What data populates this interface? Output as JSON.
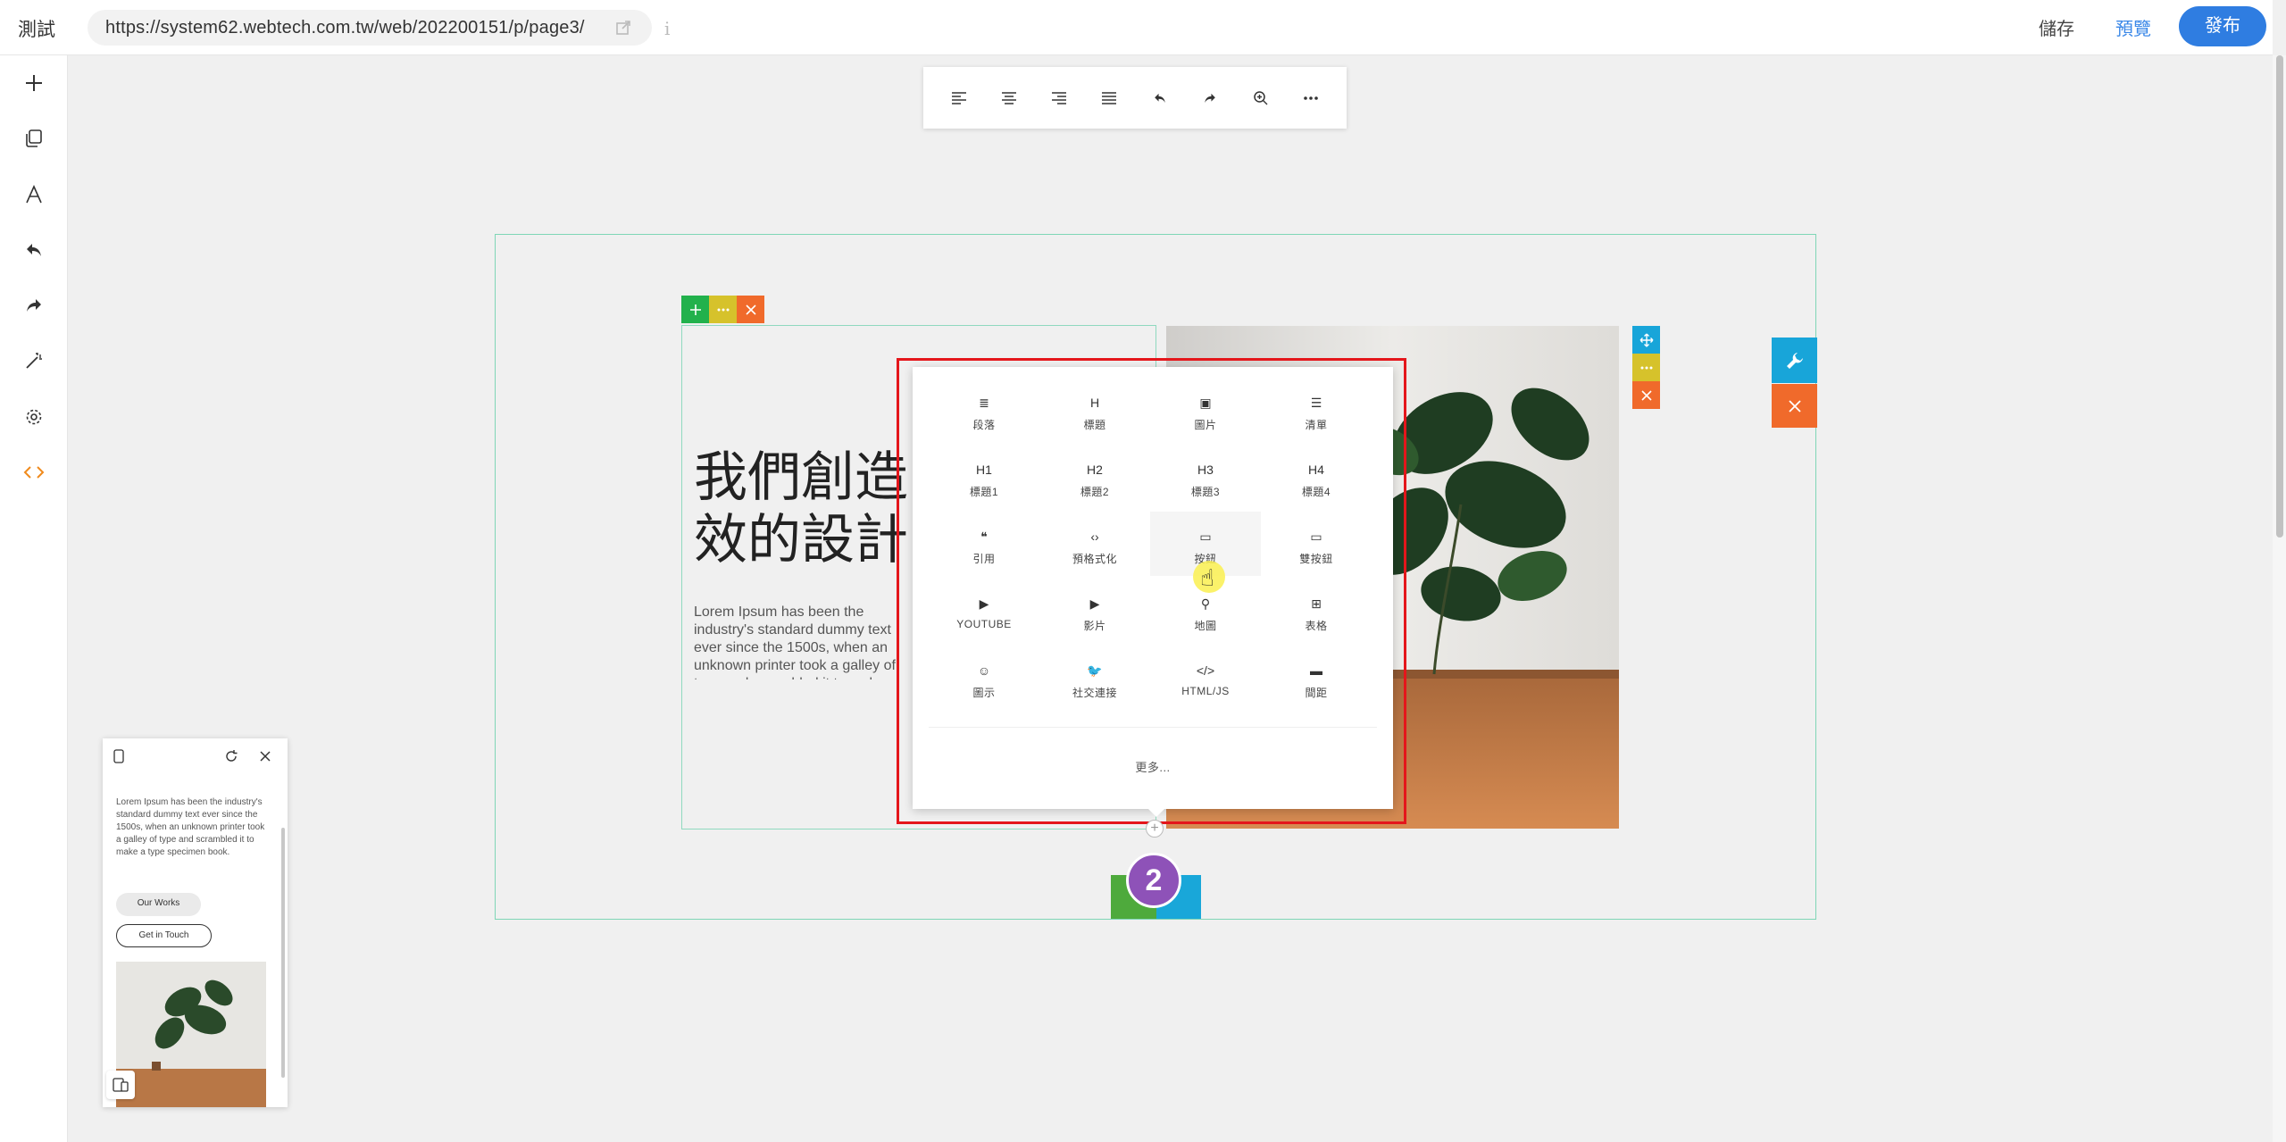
{
  "topbar": {
    "site_name": "測試",
    "url": "https://system62.webtech.com.tw/web/202200151/p/page3/",
    "info": "i",
    "save": "儲存",
    "preview": "預覽",
    "publish": "發布"
  },
  "sidebar": {
    "items": [
      "plus-icon",
      "pages-icon",
      "typography-icon",
      "undo-icon",
      "redo-icon",
      "magic-wand-icon",
      "gear-icon",
      "code-icon"
    ]
  },
  "format_toolbar": {
    "items": [
      "align-left-icon",
      "align-center-icon",
      "align-right-icon",
      "align-justify-icon",
      "undo-icon",
      "redo-icon",
      "zoom-icon",
      "more-icon"
    ]
  },
  "hero": {
    "title": "我們創造\n效的設計",
    "body": "Lorem Ipsum has been the industry's standard dummy text ever since the 1500s, when an unknown printer took a galley of type and scrambled it to make a type specimen book."
  },
  "picker": {
    "items": [
      {
        "icon": "≣",
        "label": "段落"
      },
      {
        "icon": "H",
        "label": "標題"
      },
      {
        "icon": "▣",
        "label": "圖片"
      },
      {
        "icon": "☰",
        "label": "清單"
      },
      {
        "icon": "H1",
        "label": "標題1"
      },
      {
        "icon": "H2",
        "label": "標題2"
      },
      {
        "icon": "H3",
        "label": "標題3"
      },
      {
        "icon": "H4",
        "label": "標題4"
      },
      {
        "icon": "❝",
        "label": "引用"
      },
      {
        "icon": "‹›",
        "label": "預格式化"
      },
      {
        "icon": "▭",
        "label": "按鈕"
      },
      {
        "icon": "▭",
        "label": "雙按鈕"
      },
      {
        "icon": "▶",
        "label": "YOUTUBE"
      },
      {
        "icon": "▶",
        "label": "影片"
      },
      {
        "icon": "⚲",
        "label": "地圖"
      },
      {
        "icon": "⊞",
        "label": "表格"
      },
      {
        "icon": "☺",
        "label": "圖示"
      },
      {
        "icon": "🐦",
        "label": "社交連接"
      },
      {
        "icon": "</>",
        "label": "HTML/JS"
      },
      {
        "icon": "▬",
        "label": "間距"
      }
    ],
    "more": "更多..."
  },
  "step_badge": "2",
  "mobile": {
    "body": "Lorem Ipsum has been the industry's standard dummy text ever since the 1500s, when an unknown printer took a galley of type and scrambled it to make a type specimen book.",
    "btn_works": "Our Works",
    "btn_touch": "Get in Touch"
  },
  "colors": {
    "green": "#22b14c",
    "yellow": "#d6c22b",
    "orange": "#f06a2b",
    "blue": "#18a5d9",
    "accent": "#2f7de1",
    "highlight": "#e4161b",
    "badge": "#8e52b8"
  }
}
